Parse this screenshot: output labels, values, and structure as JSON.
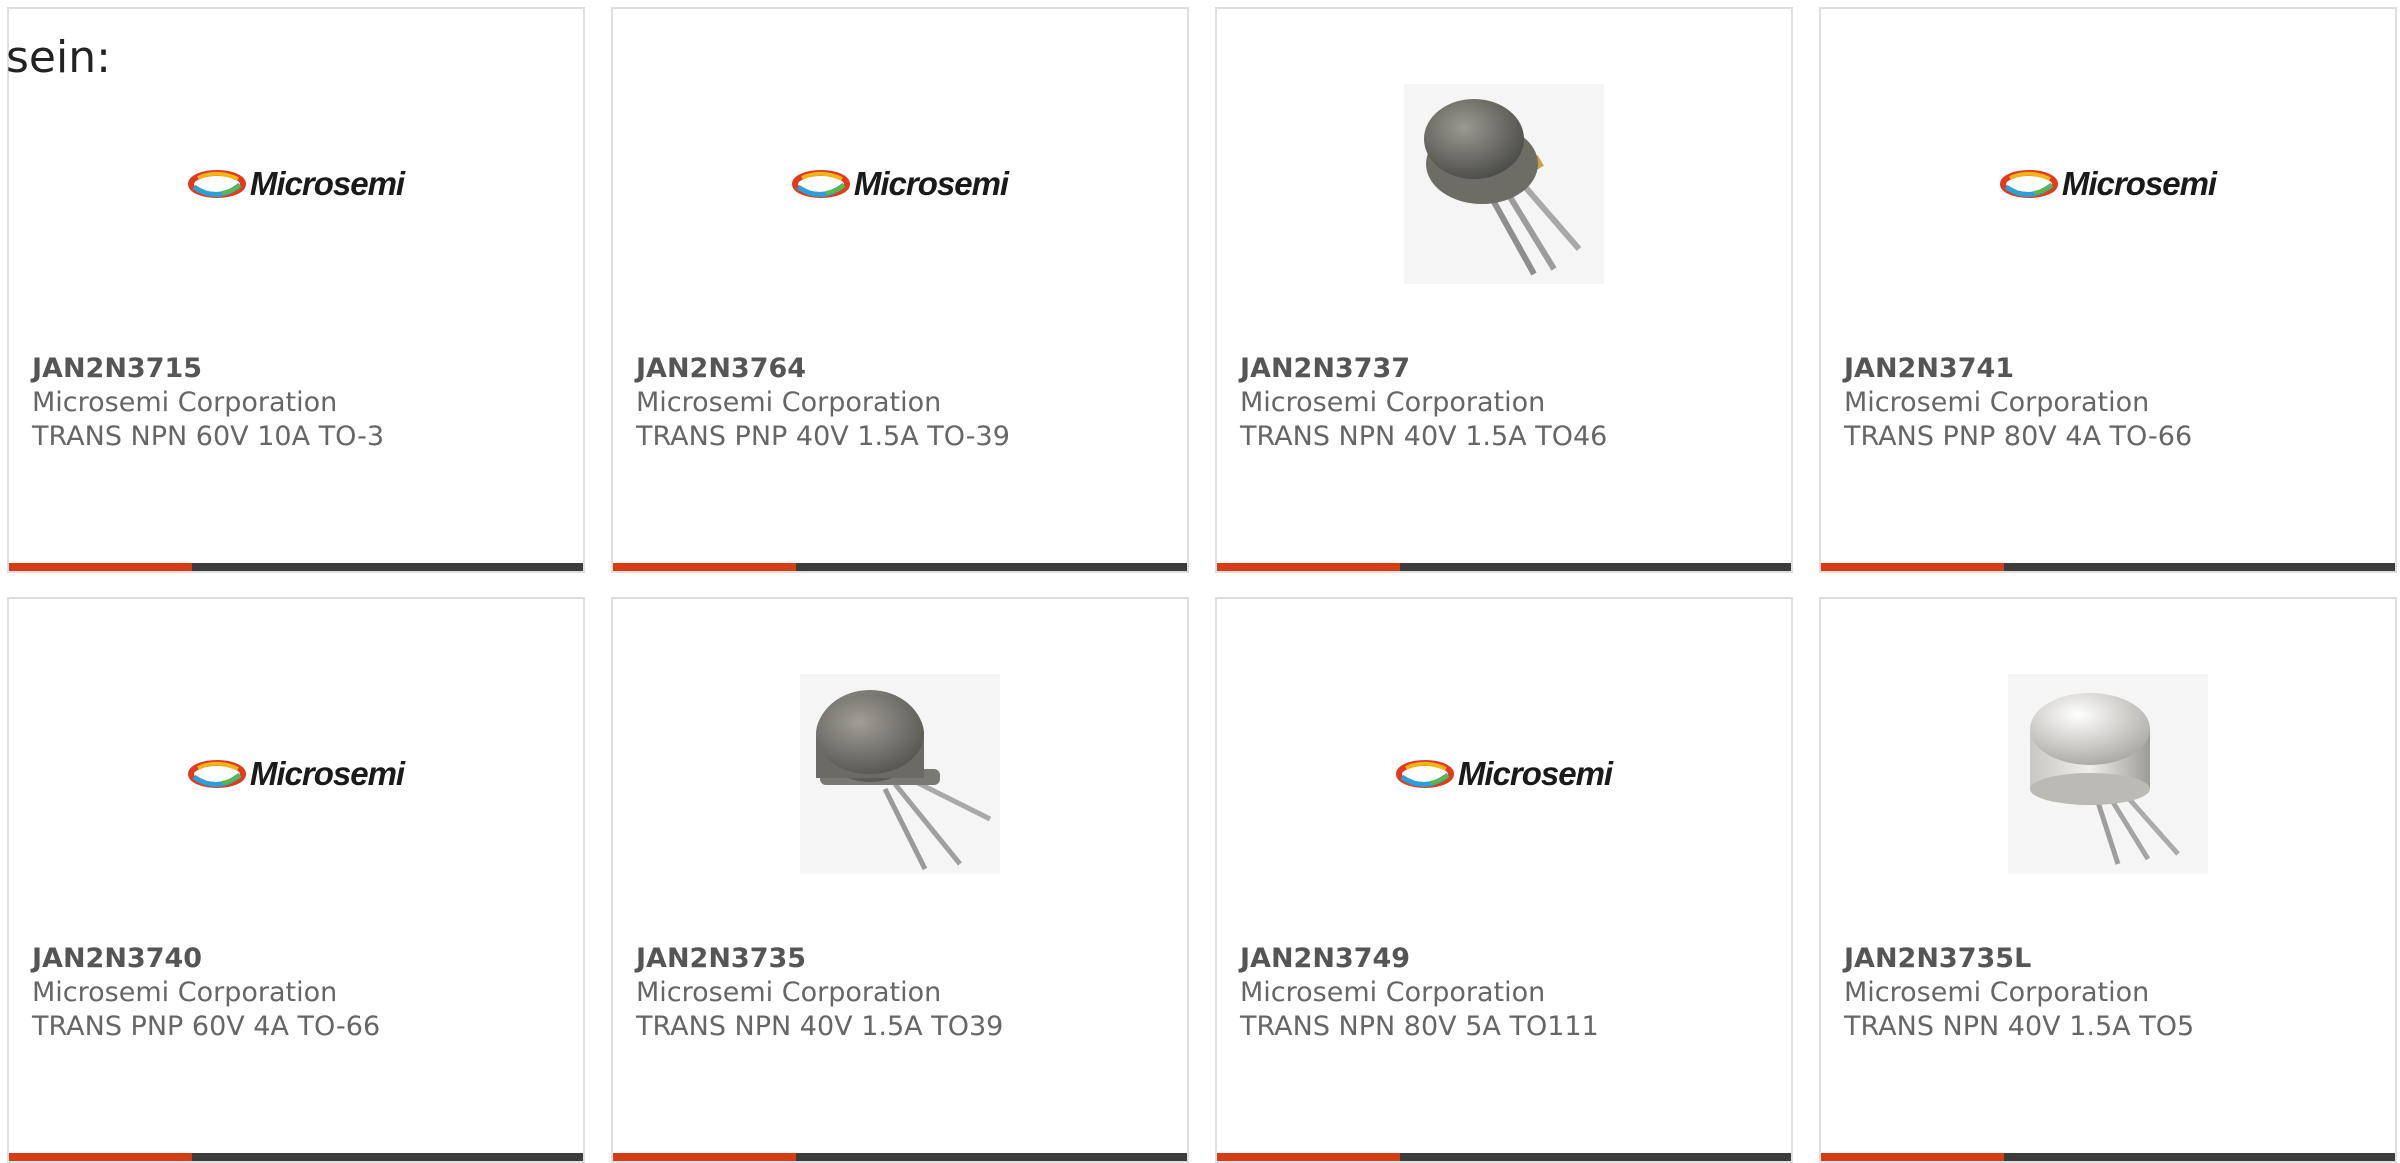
{
  "intro_text": "sein:",
  "logo_text": "Microsemi",
  "products": [
    {
      "part": "JAN2N3715",
      "manufacturer": "Microsemi Corporation",
      "description": "TRANS NPN 60V 10A TO-3",
      "image": "microsemi-logo"
    },
    {
      "part": "JAN2N3764",
      "manufacturer": "Microsemi Corporation",
      "description": "TRANS PNP 40V 1.5A TO-39",
      "image": "microsemi-logo"
    },
    {
      "part": "JAN2N3737",
      "manufacturer": "Microsemi Corporation",
      "description": "TRANS NPN 40V 1.5A TO46",
      "image": "to46-transistor-photo"
    },
    {
      "part": "JAN2N3741",
      "manufacturer": "Microsemi Corporation",
      "description": "TRANS PNP 80V 4A TO-66",
      "image": "microsemi-logo"
    },
    {
      "part": "JAN2N3740",
      "manufacturer": "Microsemi Corporation",
      "description": "TRANS PNP 60V 4A TO-66",
      "image": "microsemi-logo"
    },
    {
      "part": "JAN2N3735",
      "manufacturer": "Microsemi Corporation",
      "description": "TRANS NPN 40V 1.5A TO39",
      "image": "to39-transistor-photo"
    },
    {
      "part": "JAN2N3749",
      "manufacturer": "Microsemi Corporation",
      "description": "TRANS NPN 80V 5A TO111",
      "image": "microsemi-logo"
    },
    {
      "part": "JAN2N3735L",
      "manufacturer": "Microsemi Corporation",
      "description": "TRANS NPN 40V 1.5A TO5",
      "image": "to5-transistor-photo"
    }
  ],
  "colors": {
    "accent": "#d63d14",
    "bar_dark": "#3c3c3c",
    "text_gray": "#666666",
    "border": "#dedede"
  }
}
